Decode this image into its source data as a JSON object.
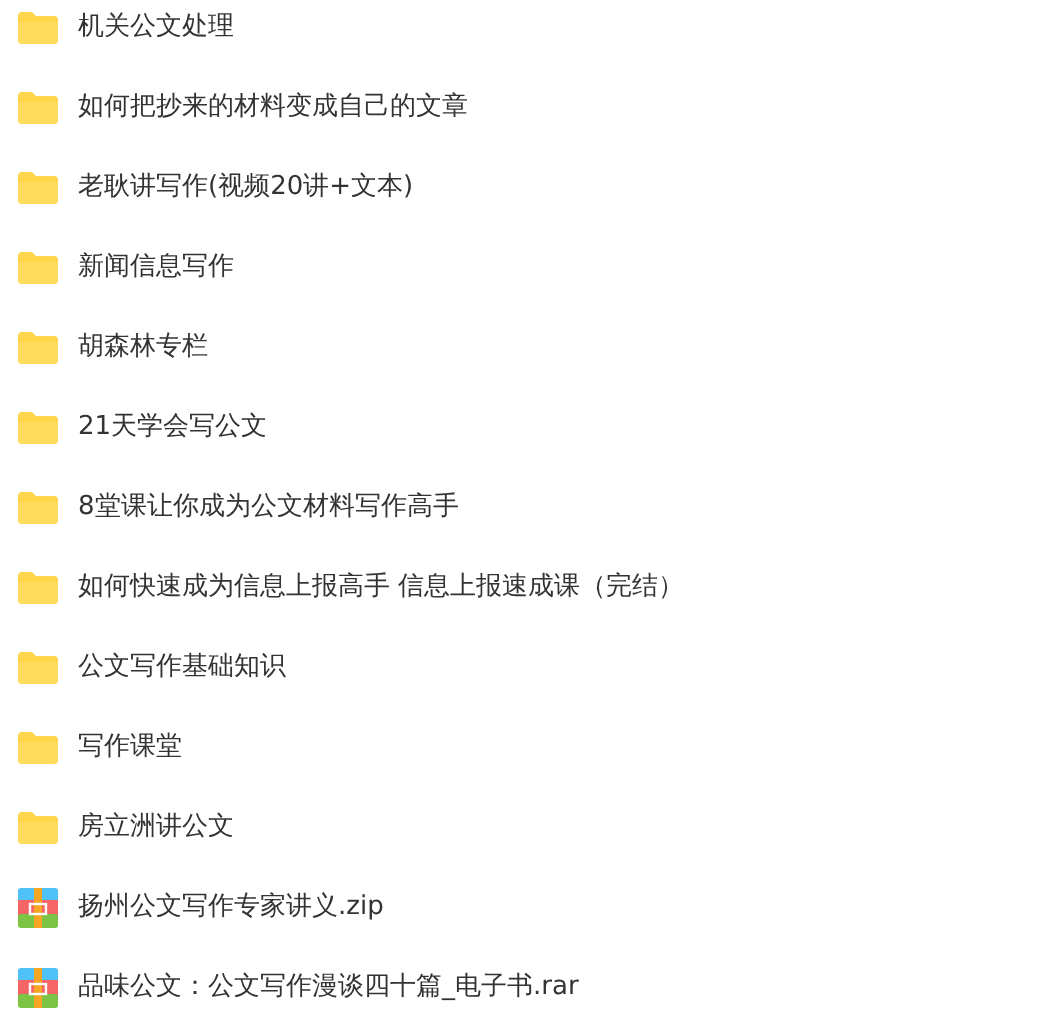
{
  "files": [
    {
      "kind": "folder",
      "name": "机关公文处理"
    },
    {
      "kind": "folder",
      "name": "如何把抄来的材料变成自己的文章"
    },
    {
      "kind": "folder",
      "name": "老耿讲写作(视频20讲+文本)"
    },
    {
      "kind": "folder",
      "name": "新闻信息写作"
    },
    {
      "kind": "folder",
      "name": "胡森林专栏"
    },
    {
      "kind": "folder",
      "name": "21天学会写公文"
    },
    {
      "kind": "folder",
      "name": "8堂课让你成为公文材料写作高手"
    },
    {
      "kind": "folder",
      "name": "如何快速成为信息上报高手 信息上报速成课（完结）"
    },
    {
      "kind": "folder",
      "name": "公文写作基础知识"
    },
    {
      "kind": "folder",
      "name": "写作课堂"
    },
    {
      "kind": "folder",
      "name": "房立洲讲公文"
    },
    {
      "kind": "archive",
      "name": "扬州公文写作专家讲义.zip"
    },
    {
      "kind": "archive",
      "name": "品味公文：公文写作漫谈四十篇_电子书.rar"
    }
  ]
}
